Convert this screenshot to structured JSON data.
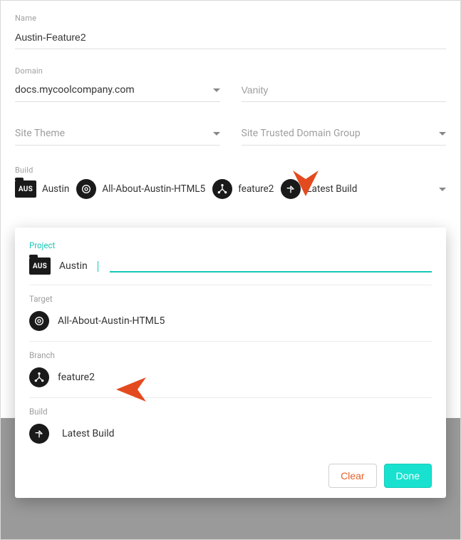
{
  "fields": {
    "name_label": "Name",
    "name_value": "Austin-Feature2",
    "domain_label": "Domain",
    "domain_value": "docs.mycoolcompany.com",
    "vanity_placeholder": "Vanity",
    "site_theme_placeholder": "Site Theme",
    "site_trusted_placeholder": "Site Trusted Domain Group",
    "build_label": "Build"
  },
  "build_chain": {
    "project_tag": "AUS",
    "project": "Austin",
    "target": "All-About-Austin-HTML5",
    "branch": "feature2",
    "build": "Latest Build"
  },
  "popover": {
    "project_label": "Project",
    "project_tag": "AUS",
    "project_value": "Austin",
    "target_label": "Target",
    "target_value": "All-About-Austin-HTML5",
    "branch_label": "Branch",
    "branch_value": "feature2",
    "build_label": "Build",
    "build_value": "Latest Build",
    "clear": "Clear",
    "done": "Done"
  }
}
